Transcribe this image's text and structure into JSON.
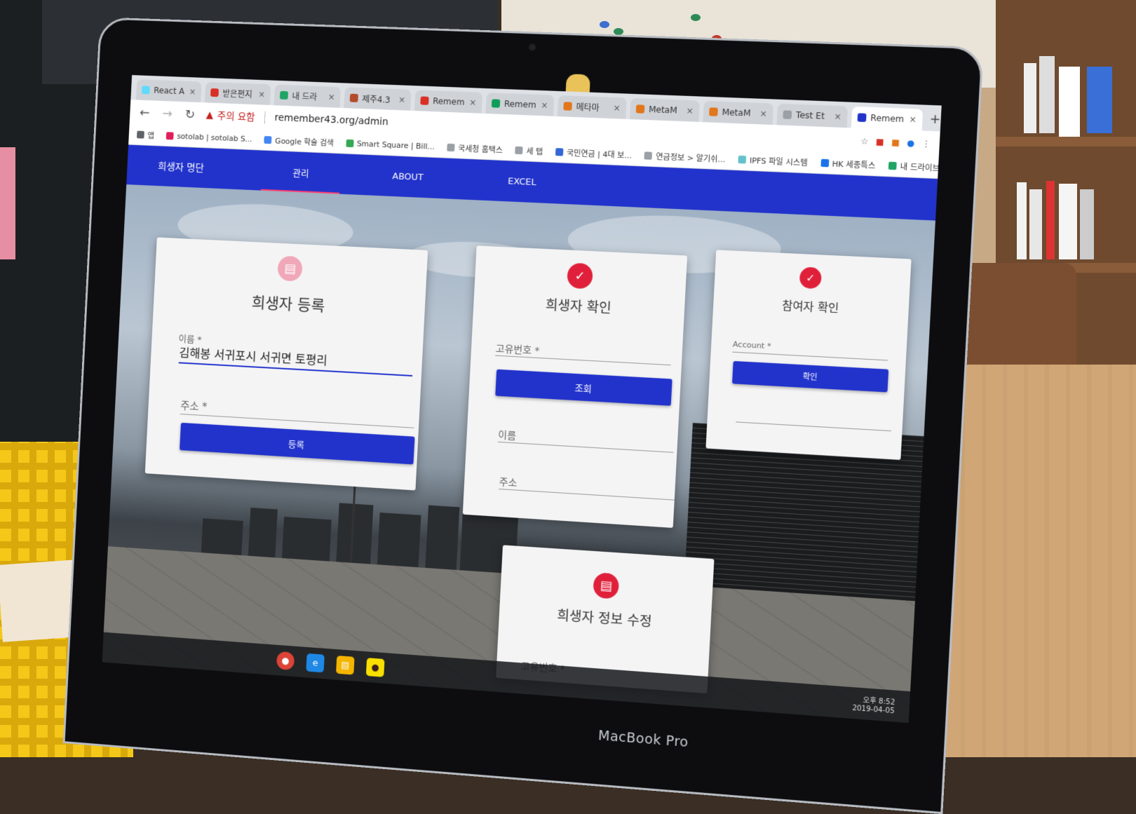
{
  "browser": {
    "tabs": [
      {
        "label": "React A",
        "color": "#61dafb",
        "active": false
      },
      {
        "label": "받은편지",
        "color": "#d93025",
        "active": false
      },
      {
        "label": "내 드라",
        "color": "#1fa463",
        "active": false
      },
      {
        "label": "제주4.3",
        "color": "#b34b2a",
        "active": false
      },
      {
        "label": "Remem",
        "color": "#d93025",
        "active": false
      },
      {
        "label": "Remem",
        "color": "#0f9d58",
        "active": false
      },
      {
        "label": "메타마",
        "color": "#e2761b",
        "active": false
      },
      {
        "label": "MetaM",
        "color": "#e2761b",
        "active": false
      },
      {
        "label": "MetaM",
        "color": "#e2761b",
        "active": false
      },
      {
        "label": "Test Et",
        "color": "#9aa0a6",
        "active": false
      },
      {
        "label": "Remem",
        "color": "#2233cc",
        "active": true
      }
    ],
    "new_tab": "+",
    "security_label": "주의 요함",
    "url": "remember43.org/admin",
    "bookmarks": [
      {
        "label": "앱",
        "color": "#5f6368"
      },
      {
        "label": "sotolab | sotolab S...",
        "color": "#e01e5a"
      },
      {
        "label": "Google 학술 검색",
        "color": "#4285f4"
      },
      {
        "label": "Smart Square | Bill...",
        "color": "#34a853"
      },
      {
        "label": "국세청 홈택스",
        "color": "#9aa0a6"
      },
      {
        "label": "세 탭",
        "color": "#9aa0a6"
      },
      {
        "label": "국민연금 | 4대 보...",
        "color": "#3367d6"
      },
      {
        "label": "연금정보 > 알기쉬...",
        "color": "#9aa0a6"
      },
      {
        "label": "IPFS 파일 시스템",
        "color": "#65c2cb"
      },
      {
        "label": "HK 세종특스",
        "color": "#1a73e8"
      },
      {
        "label": "내 드라이브 - Goo...",
        "color": "#1fa463"
      }
    ]
  },
  "app": {
    "nav": {
      "brand": "희생자 명단",
      "items": [
        "관리",
        "ABOUT",
        "EXCEL"
      ],
      "active_index": 0
    },
    "register_card": {
      "title": "희생자 등록",
      "icon": "id-card-icon",
      "name_label": "이름 *",
      "name_value": "김해봉   서귀포시 서귀면 토평리",
      "address_label": "주소 *",
      "button": "등록"
    },
    "verify_card": {
      "title": "희생자 확인",
      "icon": "check-circle-icon",
      "id_label": "고유번호 *",
      "button": "조회",
      "name_label": "이름",
      "address_label": "주소"
    },
    "participant_card": {
      "title": "참여자 확인",
      "icon": "check-circle-icon",
      "account_label": "Account *",
      "button": "확인"
    },
    "edit_card": {
      "title": "희생자 정보 수정",
      "icon": "id-card-icon",
      "id_label": "고유번호 *"
    }
  },
  "device": {
    "brand": "MacBook Pro"
  },
  "taskbar": {
    "clock_time": "오후 8:52",
    "clock_date": "2019-04-05"
  }
}
